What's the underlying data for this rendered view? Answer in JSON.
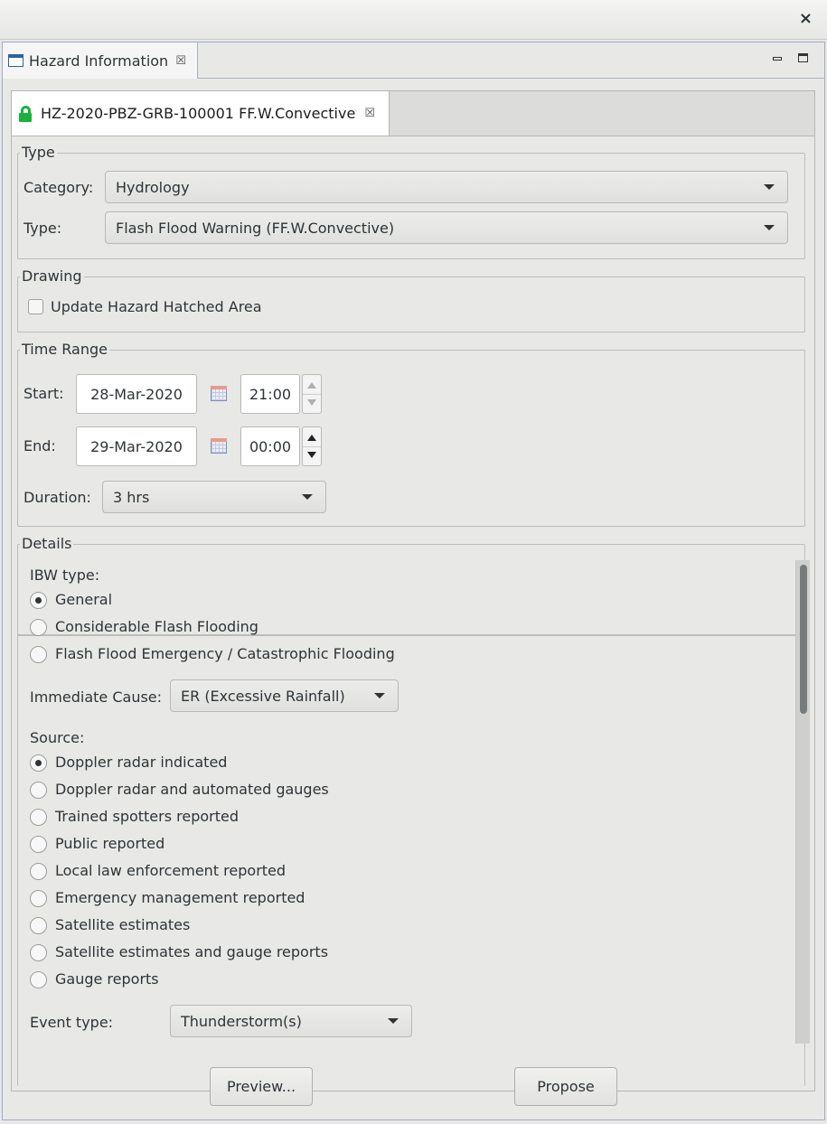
{
  "window": {
    "close_glyph": "×"
  },
  "view": {
    "tab_label": "Hazard Information",
    "tab_close_glyph": "☒",
    "minimize_icon": "minimize-icon",
    "maximize_icon": "maximize-icon"
  },
  "editor": {
    "tab_label": "HZ-2020-PBZ-GRB-100001 FF.W.Convective",
    "tab_close_glyph": "☒",
    "lock_color": "#19b33b"
  },
  "type_group": {
    "legend": "Type",
    "category_label": "Category:",
    "category_value": "Hydrology",
    "type_label": "Type:",
    "type_value": "Flash Flood Warning (FF.W.Convective)"
  },
  "drawing_group": {
    "legend": "Drawing",
    "update_hatched_label": "Update Hazard Hatched Area",
    "update_hatched_checked": false
  },
  "time_group": {
    "legend": "Time Range",
    "start_label": "Start:",
    "start_date": "28-Mar-2020",
    "start_time": "21:00",
    "end_label": "End:",
    "end_date": "29-Mar-2020",
    "end_time": "00:00",
    "duration_label": "Duration:",
    "duration_value": "3 hrs"
  },
  "details_group": {
    "legend": "Details",
    "ibw_label": "IBW type:",
    "ibw_options": [
      {
        "label": "General",
        "selected": true
      },
      {
        "label": "Considerable Flash Flooding",
        "selected": false
      },
      {
        "label": "Flash Flood Emergency / Catastrophic Flooding",
        "selected": false
      }
    ],
    "immediate_cause_label": "Immediate Cause:",
    "immediate_cause_value": "ER (Excessive Rainfall)",
    "source_label": "Source:",
    "source_options": [
      {
        "label": "Doppler radar indicated",
        "selected": true
      },
      {
        "label": "Doppler radar and automated gauges",
        "selected": false
      },
      {
        "label": "Trained spotters reported",
        "selected": false
      },
      {
        "label": "Public reported",
        "selected": false
      },
      {
        "label": "Local law enforcement reported",
        "selected": false
      },
      {
        "label": "Emergency management reported",
        "selected": false
      },
      {
        "label": "Satellite estimates",
        "selected": false
      },
      {
        "label": "Satellite estimates and gauge reports",
        "selected": false
      },
      {
        "label": "Gauge reports",
        "selected": false
      }
    ],
    "event_type_label": "Event type:",
    "event_type_value": "Thunderstorm(s)"
  },
  "buttons": {
    "preview": "Preview...",
    "propose": "Propose"
  }
}
